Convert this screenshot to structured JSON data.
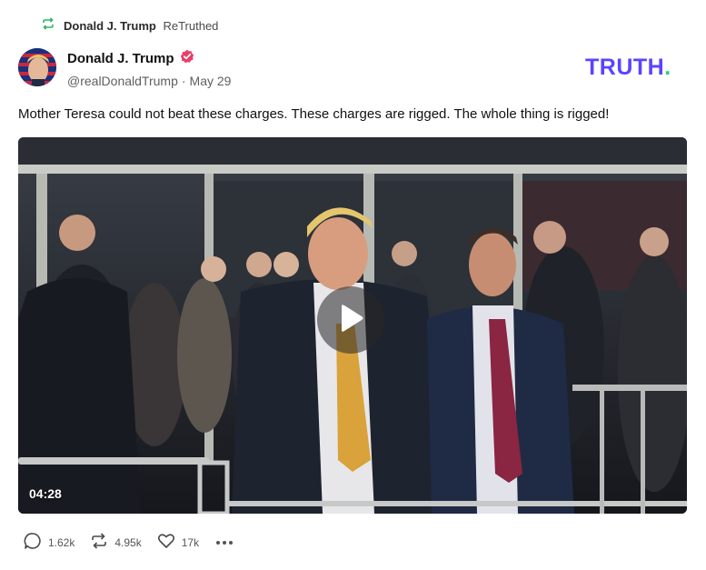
{
  "retruth": {
    "icon": "retruth-icon",
    "name": "Donald J. Trump",
    "verb": "ReTruthed"
  },
  "author": {
    "name": "Donald J. Trump",
    "verified": true,
    "handle": "@realDonaldTrump",
    "separator": "·",
    "date": "May 29"
  },
  "brand": {
    "text": "TRUTH",
    "dot": ".",
    "color": "#5a44ff",
    "dot_color": "#26d07c"
  },
  "post": {
    "text": "Mother Teresa could not beat these charges. These charges are rigged. The whole thing is rigged!"
  },
  "media": {
    "type": "video",
    "duration": "04:28",
    "play_icon": "play-icon"
  },
  "actions": {
    "replies": "1.62k",
    "retruths": "4.95k",
    "likes": "17k",
    "more_icon": "more-icon"
  },
  "colors": {
    "retruth_icon": "#2fb36b",
    "verified_badge": "#e8406a",
    "text": "#111111",
    "muted": "#606060"
  }
}
